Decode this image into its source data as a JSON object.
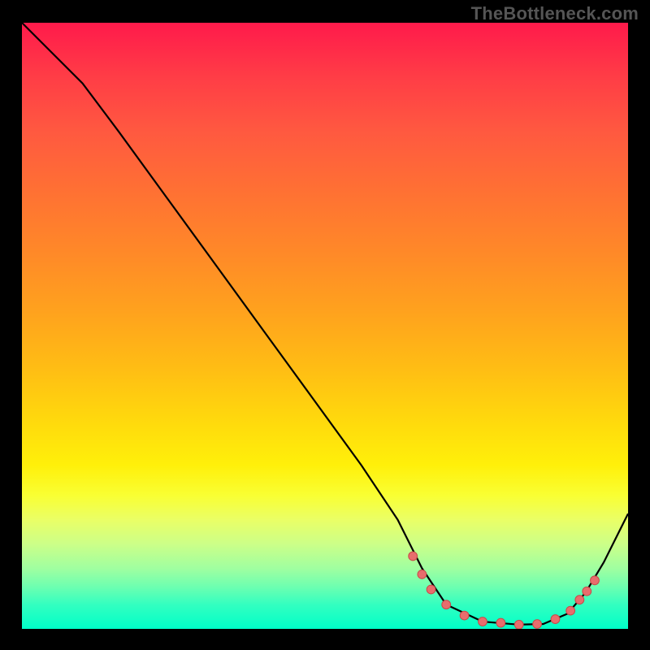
{
  "watermark": "TheBottleneck.com",
  "colors": {
    "curve_stroke": "#000000",
    "dot_fill": "#e86d6d",
    "dot_stroke": "#c94848",
    "gradient_top": "#ff1a4b",
    "gradient_bottom": "#00ffc8",
    "page_background": "#000000"
  },
  "chart_data": {
    "type": "line",
    "title": "",
    "xlabel": "",
    "ylabel": "",
    "xlim": [
      0,
      100
    ],
    "ylim": [
      0,
      100
    ],
    "grid": false,
    "legend": false,
    "note": "x is horizontal position (0=left,100=right); y is vertical distance from bottom (0=bottom,100=top). Curve starts top-left, descends near-linearly, flattens near bottom (~x 66-90), then rises toward bottom-right.",
    "series": [
      {
        "name": "bottleneck-curve",
        "x": [
          0,
          3,
          6,
          10,
          16,
          24,
          32,
          40,
          48,
          56,
          62,
          66,
          70,
          76,
          82,
          86,
          90,
          93,
          96,
          100
        ],
        "y": [
          100,
          97,
          94,
          90,
          82,
          71,
          60,
          49,
          38,
          27,
          18,
          10,
          4,
          1.2,
          0.7,
          0.8,
          2.5,
          6,
          11,
          19
        ]
      }
    ],
    "dots": {
      "comment": "pink markers near the trough and on the rising segment",
      "x": [
        64.5,
        66,
        67.5,
        70,
        73,
        76,
        79,
        82,
        85,
        88,
        90.5,
        92,
        93.2,
        94.5
      ],
      "y": [
        12,
        9,
        6.5,
        4,
        2.2,
        1.2,
        1.0,
        0.7,
        0.8,
        1.6,
        3.0,
        4.8,
        6.2,
        8.0
      ]
    },
    "dot_radius": 5.4
  }
}
